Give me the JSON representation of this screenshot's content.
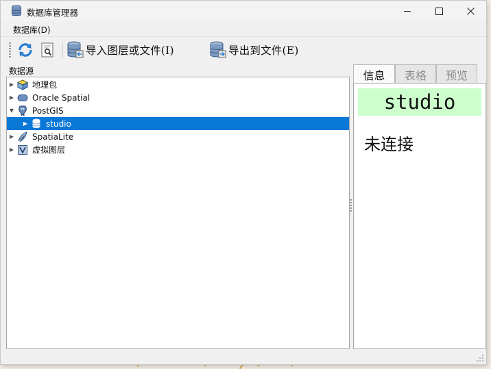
{
  "window": {
    "title": "数据库管理器",
    "controls": {
      "minimize": "—",
      "maximize": "☐",
      "close": "✕"
    }
  },
  "menubar": {
    "items": [
      {
        "label": "数据库(D)"
      }
    ]
  },
  "toolbar": {
    "refresh_icon": "refresh-icon",
    "info_icon": "sql-window-icon",
    "import_label": "导入图层或文件(I)",
    "export_label": "导出到文件(E)"
  },
  "datasource": {
    "header": "数据源",
    "items": [
      {
        "label": "地理包",
        "icon": "geopackage-icon",
        "expanded": false
      },
      {
        "label": "Oracle Spatial",
        "icon": "oracle-icon",
        "expanded": false
      },
      {
        "label": "PostGIS",
        "icon": "postgis-icon",
        "expanded": true,
        "children": [
          {
            "label": "studio",
            "icon": "database-icon",
            "selected": true
          }
        ]
      },
      {
        "label": "SpatiaLite",
        "icon": "spatialite-icon",
        "expanded": false
      },
      {
        "label": "虚拟图层",
        "icon": "virtual-layer-icon",
        "expanded": false
      }
    ]
  },
  "tabs": [
    {
      "label": "信息",
      "active": true
    },
    {
      "label": "表格",
      "active": false
    },
    {
      "label": "预览",
      "active": false
    }
  ],
  "info": {
    "title": "studio",
    "status": "未连接"
  },
  "colors": {
    "selection": "#0a78d7",
    "info_title_bg": "#ccffcc"
  }
}
